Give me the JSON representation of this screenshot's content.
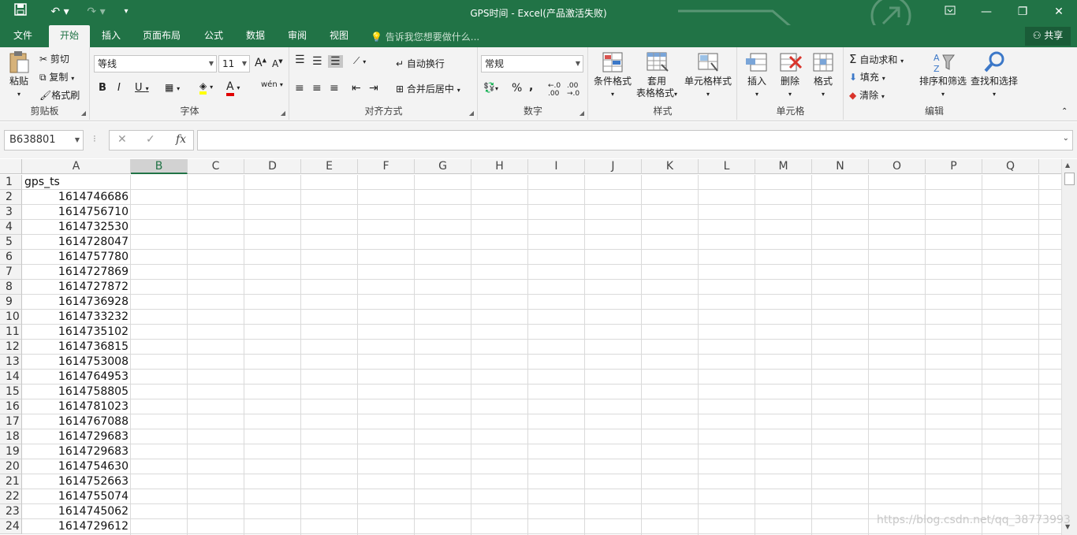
{
  "title": "GPS时间 - Excel(产品激活失败)",
  "tabs": [
    "文件",
    "开始",
    "插入",
    "页面布局",
    "公式",
    "数据",
    "审阅",
    "视图"
  ],
  "active_tab": "开始",
  "tellme": "告诉我您想要做什么...",
  "share": "共享",
  "clipboard": {
    "paste": "粘贴",
    "cut": "剪切",
    "copy": "复制",
    "format_painter": "格式刷",
    "label": "剪贴板"
  },
  "font": {
    "name": "等线",
    "size": "11",
    "label": "字体",
    "bold": "B",
    "italic": "I",
    "underline": "U",
    "grow": "A",
    "shrink": "A",
    "color_letter": "A",
    "phonetic": "wén"
  },
  "alignment": {
    "wrap": "自动换行",
    "merge": "合并后居中",
    "label": "对齐方式"
  },
  "number": {
    "format": "常规",
    "percent": "%",
    "comma": ",",
    "label": "数字"
  },
  "styles": {
    "conditional": "条件格式",
    "table": "套用",
    "table2": "表格格式",
    "cell_styles": "单元格样式",
    "label": "样式"
  },
  "cells": {
    "insert": "插入",
    "delete": "删除",
    "format": "格式",
    "label": "单元格"
  },
  "editing": {
    "autosum": "自动求和",
    "fill": "填充",
    "clear": "清除",
    "sort": "排序和筛选",
    "find": "查找和选择",
    "label": "编辑"
  },
  "namebox": "B638801",
  "fx": "fx",
  "columns": [
    "A",
    "B",
    "C",
    "D",
    "E",
    "F",
    "G",
    "H",
    "I",
    "J",
    "K",
    "L",
    "M",
    "N",
    "O",
    "P",
    "Q"
  ],
  "selected_column": "B",
  "rows": [
    "1",
    "2",
    "3",
    "4",
    "5",
    "6",
    "7",
    "8",
    "9",
    "10",
    "11",
    "12",
    "13",
    "14",
    "15",
    "16",
    "17",
    "18",
    "19",
    "20",
    "21",
    "22",
    "23",
    "24"
  ],
  "column_a": [
    "gps_ts",
    "1614746686",
    "1614756710",
    "1614732530",
    "1614728047",
    "1614757780",
    "1614727869",
    "1614727872",
    "1614736928",
    "1614733232",
    "1614735102",
    "1614736815",
    "1614753008",
    "1614764953",
    "1614758805",
    "1614781023",
    "1614767088",
    "1614729683",
    "1614729683",
    "1614754630",
    "1614752663",
    "1614755074",
    "1614745062",
    "1614729612"
  ],
  "watermark": "https://blog.csdn.net/qq_38773993",
  "colors": {
    "accent": "#217346",
    "ribbon": "#f3f3f3"
  }
}
